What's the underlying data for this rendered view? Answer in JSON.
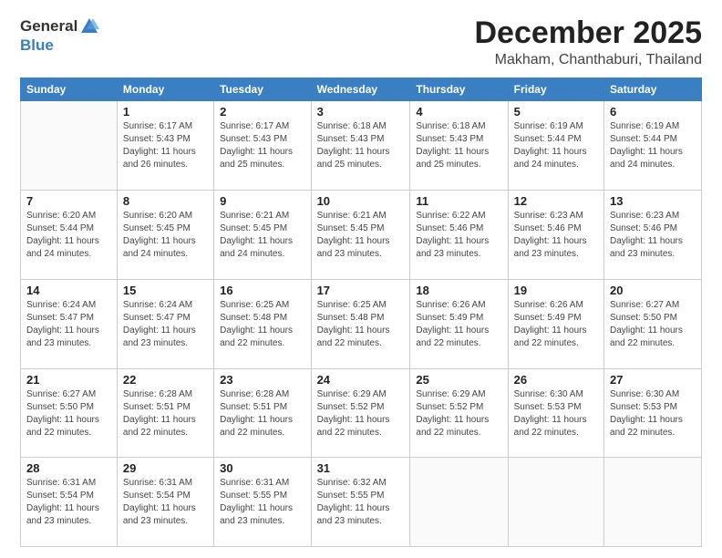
{
  "logo": {
    "general": "General",
    "blue": "Blue"
  },
  "header": {
    "month": "December 2025",
    "location": "Makham, Chanthaburi, Thailand"
  },
  "days_header": [
    "Sunday",
    "Monday",
    "Tuesday",
    "Wednesday",
    "Thursday",
    "Friday",
    "Saturday"
  ],
  "weeks": [
    [
      {
        "day": "",
        "sunrise": "",
        "sunset": "",
        "daylight": ""
      },
      {
        "day": "1",
        "sunrise": "Sunrise: 6:17 AM",
        "sunset": "Sunset: 5:43 PM",
        "daylight": "Daylight: 11 hours and 26 minutes."
      },
      {
        "day": "2",
        "sunrise": "Sunrise: 6:17 AM",
        "sunset": "Sunset: 5:43 PM",
        "daylight": "Daylight: 11 hours and 25 minutes."
      },
      {
        "day": "3",
        "sunrise": "Sunrise: 6:18 AM",
        "sunset": "Sunset: 5:43 PM",
        "daylight": "Daylight: 11 hours and 25 minutes."
      },
      {
        "day": "4",
        "sunrise": "Sunrise: 6:18 AM",
        "sunset": "Sunset: 5:43 PM",
        "daylight": "Daylight: 11 hours and 25 minutes."
      },
      {
        "day": "5",
        "sunrise": "Sunrise: 6:19 AM",
        "sunset": "Sunset: 5:44 PM",
        "daylight": "Daylight: 11 hours and 24 minutes."
      },
      {
        "day": "6",
        "sunrise": "Sunrise: 6:19 AM",
        "sunset": "Sunset: 5:44 PM",
        "daylight": "Daylight: 11 hours and 24 minutes."
      }
    ],
    [
      {
        "day": "7",
        "sunrise": "Sunrise: 6:20 AM",
        "sunset": "Sunset: 5:44 PM",
        "daylight": "Daylight: 11 hours and 24 minutes."
      },
      {
        "day": "8",
        "sunrise": "Sunrise: 6:20 AM",
        "sunset": "Sunset: 5:45 PM",
        "daylight": "Daylight: 11 hours and 24 minutes."
      },
      {
        "day": "9",
        "sunrise": "Sunrise: 6:21 AM",
        "sunset": "Sunset: 5:45 PM",
        "daylight": "Daylight: 11 hours and 24 minutes."
      },
      {
        "day": "10",
        "sunrise": "Sunrise: 6:21 AM",
        "sunset": "Sunset: 5:45 PM",
        "daylight": "Daylight: 11 hours and 23 minutes."
      },
      {
        "day": "11",
        "sunrise": "Sunrise: 6:22 AM",
        "sunset": "Sunset: 5:46 PM",
        "daylight": "Daylight: 11 hours and 23 minutes."
      },
      {
        "day": "12",
        "sunrise": "Sunrise: 6:23 AM",
        "sunset": "Sunset: 5:46 PM",
        "daylight": "Daylight: 11 hours and 23 minutes."
      },
      {
        "day": "13",
        "sunrise": "Sunrise: 6:23 AM",
        "sunset": "Sunset: 5:46 PM",
        "daylight": "Daylight: 11 hours and 23 minutes."
      }
    ],
    [
      {
        "day": "14",
        "sunrise": "Sunrise: 6:24 AM",
        "sunset": "Sunset: 5:47 PM",
        "daylight": "Daylight: 11 hours and 23 minutes."
      },
      {
        "day": "15",
        "sunrise": "Sunrise: 6:24 AM",
        "sunset": "Sunset: 5:47 PM",
        "daylight": "Daylight: 11 hours and 23 minutes."
      },
      {
        "day": "16",
        "sunrise": "Sunrise: 6:25 AM",
        "sunset": "Sunset: 5:48 PM",
        "daylight": "Daylight: 11 hours and 22 minutes."
      },
      {
        "day": "17",
        "sunrise": "Sunrise: 6:25 AM",
        "sunset": "Sunset: 5:48 PM",
        "daylight": "Daylight: 11 hours and 22 minutes."
      },
      {
        "day": "18",
        "sunrise": "Sunrise: 6:26 AM",
        "sunset": "Sunset: 5:49 PM",
        "daylight": "Daylight: 11 hours and 22 minutes."
      },
      {
        "day": "19",
        "sunrise": "Sunrise: 6:26 AM",
        "sunset": "Sunset: 5:49 PM",
        "daylight": "Daylight: 11 hours and 22 minutes."
      },
      {
        "day": "20",
        "sunrise": "Sunrise: 6:27 AM",
        "sunset": "Sunset: 5:50 PM",
        "daylight": "Daylight: 11 hours and 22 minutes."
      }
    ],
    [
      {
        "day": "21",
        "sunrise": "Sunrise: 6:27 AM",
        "sunset": "Sunset: 5:50 PM",
        "daylight": "Daylight: 11 hours and 22 minutes."
      },
      {
        "day": "22",
        "sunrise": "Sunrise: 6:28 AM",
        "sunset": "Sunset: 5:51 PM",
        "daylight": "Daylight: 11 hours and 22 minutes."
      },
      {
        "day": "23",
        "sunrise": "Sunrise: 6:28 AM",
        "sunset": "Sunset: 5:51 PM",
        "daylight": "Daylight: 11 hours and 22 minutes."
      },
      {
        "day": "24",
        "sunrise": "Sunrise: 6:29 AM",
        "sunset": "Sunset: 5:52 PM",
        "daylight": "Daylight: 11 hours and 22 minutes."
      },
      {
        "day": "25",
        "sunrise": "Sunrise: 6:29 AM",
        "sunset": "Sunset: 5:52 PM",
        "daylight": "Daylight: 11 hours and 22 minutes."
      },
      {
        "day": "26",
        "sunrise": "Sunrise: 6:30 AM",
        "sunset": "Sunset: 5:53 PM",
        "daylight": "Daylight: 11 hours and 22 minutes."
      },
      {
        "day": "27",
        "sunrise": "Sunrise: 6:30 AM",
        "sunset": "Sunset: 5:53 PM",
        "daylight": "Daylight: 11 hours and 22 minutes."
      }
    ],
    [
      {
        "day": "28",
        "sunrise": "Sunrise: 6:31 AM",
        "sunset": "Sunset: 5:54 PM",
        "daylight": "Daylight: 11 hours and 23 minutes."
      },
      {
        "day": "29",
        "sunrise": "Sunrise: 6:31 AM",
        "sunset": "Sunset: 5:54 PM",
        "daylight": "Daylight: 11 hours and 23 minutes."
      },
      {
        "day": "30",
        "sunrise": "Sunrise: 6:31 AM",
        "sunset": "Sunset: 5:55 PM",
        "daylight": "Daylight: 11 hours and 23 minutes."
      },
      {
        "day": "31",
        "sunrise": "Sunrise: 6:32 AM",
        "sunset": "Sunset: 5:55 PM",
        "daylight": "Daylight: 11 hours and 23 minutes."
      },
      {
        "day": "",
        "sunrise": "",
        "sunset": "",
        "daylight": ""
      },
      {
        "day": "",
        "sunrise": "",
        "sunset": "",
        "daylight": ""
      },
      {
        "day": "",
        "sunrise": "",
        "sunset": "",
        "daylight": ""
      }
    ]
  ]
}
